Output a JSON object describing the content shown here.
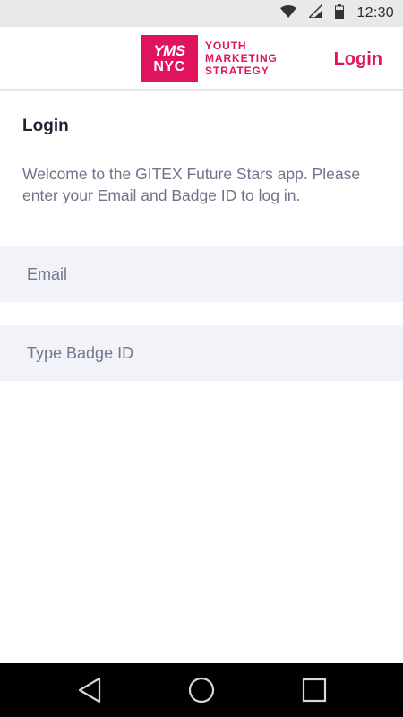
{
  "status_bar": {
    "time": "12:30",
    "icons": [
      "wifi-icon",
      "signal-icon",
      "battery-icon"
    ]
  },
  "header": {
    "logo": {
      "badge_line1": "YMS",
      "badge_line2": "NYC",
      "text_lines": [
        "YOUTH",
        "MARKETING",
        "STRATEGY"
      ]
    },
    "login_label": "Login",
    "accent_color": "#e0135f"
  },
  "main": {
    "title": "Login",
    "description": "Welcome to the GITEX Future Stars app. Please enter your Email and Badge ID to log in.",
    "email_field": {
      "value": "",
      "placeholder": "Email"
    },
    "badge_field": {
      "value": "",
      "placeholder": "Type Badge ID"
    }
  },
  "nav_bar": {
    "buttons": [
      "back-icon",
      "home-icon",
      "recents-icon"
    ]
  }
}
